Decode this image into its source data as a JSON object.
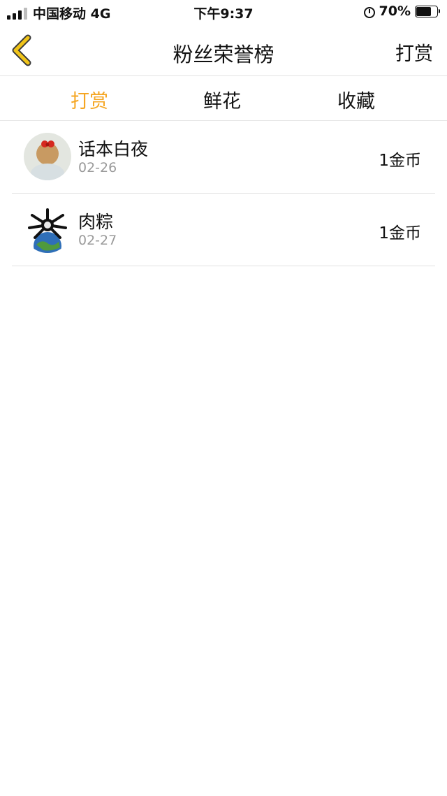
{
  "status_bar": {
    "carrier": "中国移动 4G",
    "time": "下午9:37",
    "battery": "70%",
    "icons": [
      "signal-icon",
      "alarm-icon",
      "battery-icon"
    ]
  },
  "nav": {
    "title": "粉丝荣誉榜",
    "action": "打赏",
    "back_icon": "chevron-left-icon"
  },
  "tabs": [
    {
      "label": "打赏",
      "active": true
    },
    {
      "label": "鲜花",
      "active": false
    },
    {
      "label": "收藏",
      "active": false
    }
  ],
  "list": [
    {
      "name": "话本白夜",
      "date": "02-26",
      "amount": "1金币"
    },
    {
      "name": "肉粽",
      "date": "02-27",
      "amount": "1金币"
    }
  ],
  "colors": {
    "accent": "#f5a623",
    "back_arrow": "#f0c419",
    "secondary_text": "#9a9a9a",
    "divider": "#e2e2e2"
  }
}
